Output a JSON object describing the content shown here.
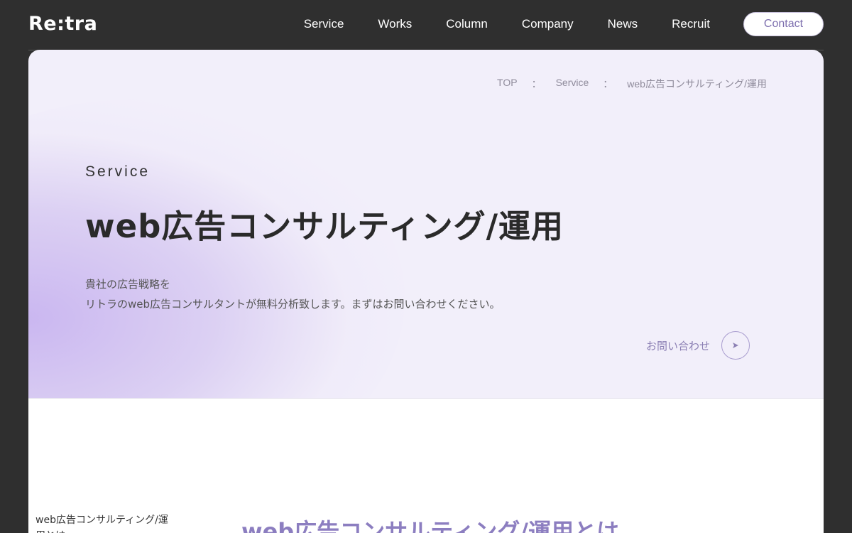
{
  "header": {
    "logo": "Re:tra",
    "nav": [
      "Service",
      "Works",
      "Column",
      "Company",
      "News",
      "Recruit"
    ],
    "contact_label": "Contact"
  },
  "breadcrumb": {
    "items": [
      "TOP",
      "Service",
      "web広告コンサルティング/運用"
    ],
    "separator": "："
  },
  "hero": {
    "sub": "Service",
    "title": "web広告コンサルティング/運用",
    "desc_line1": "貴社の広告戦略を",
    "desc_line2": "リトラのweb広告コンサルタントが無料分析致します。まずはお問い合わせください。",
    "cta_label": "お問い合わせ"
  },
  "content": {
    "side_title": "web広告コンサルティング/運用とは",
    "section_title": "web広告コンサルティング/運用とは"
  },
  "colors": {
    "accent": "#8c7ec0",
    "background": "#2f2f2f",
    "hero_bg": "#f2effa"
  }
}
